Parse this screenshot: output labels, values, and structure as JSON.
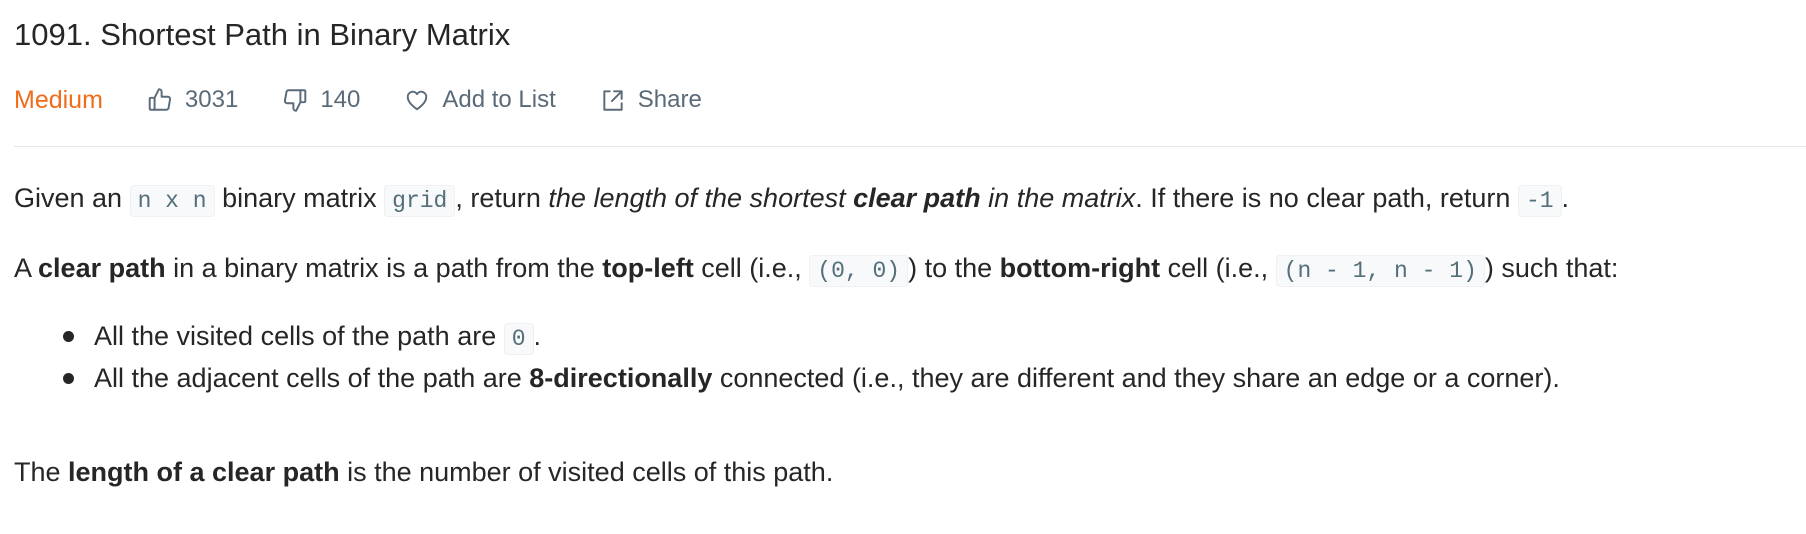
{
  "problem": {
    "title": "1091. Shortest Path in Binary Matrix",
    "difficulty": "Medium",
    "likes": "3031",
    "dislikes": "140",
    "add_to_list": "Add to List",
    "share": "Share"
  },
  "icons": {
    "like": "thumbs-up-icon",
    "dislike": "thumbs-down-icon",
    "add": "heart-icon",
    "share": "share-icon"
  },
  "colors": {
    "difficulty": "#ef6c1a",
    "meta_text": "#5a6a78",
    "body_text": "#262626"
  },
  "description": {
    "p1": {
      "t1": "Given an ",
      "c1": "n x n",
      "t2": " binary matrix ",
      "c2": "grid",
      "t3": ", return ",
      "i1": "the length of the shortest ",
      "ib1": "clear path",
      "i2": " in the matrix",
      "t4": ". If there is no clear path, return ",
      "c3": "-1",
      "t5": "."
    },
    "p2": {
      "t1": "A ",
      "b1": "clear path",
      "t2": " in a binary matrix is a path from the ",
      "b2": "top-left",
      "t3": " cell (i.e., ",
      "c1": "(0, 0)",
      "t4": ") to the ",
      "b3": "bottom-right",
      "t5": " cell (i.e., ",
      "c2": "(n - 1, n - 1)",
      "t6": ") such that:"
    },
    "bullets": {
      "b1": {
        "t1": "All the visited cells of the path are ",
        "c1": "0",
        "t2": "."
      },
      "b2": {
        "t1": "All the adjacent cells of the path are ",
        "b1": "8-directionally",
        "t2": " connected (i.e., they are different and they share an edge or a corner)."
      }
    },
    "p3": {
      "t1": "The ",
      "b1": "length of a clear path",
      "t2": " is the number of visited cells of this path."
    }
  }
}
